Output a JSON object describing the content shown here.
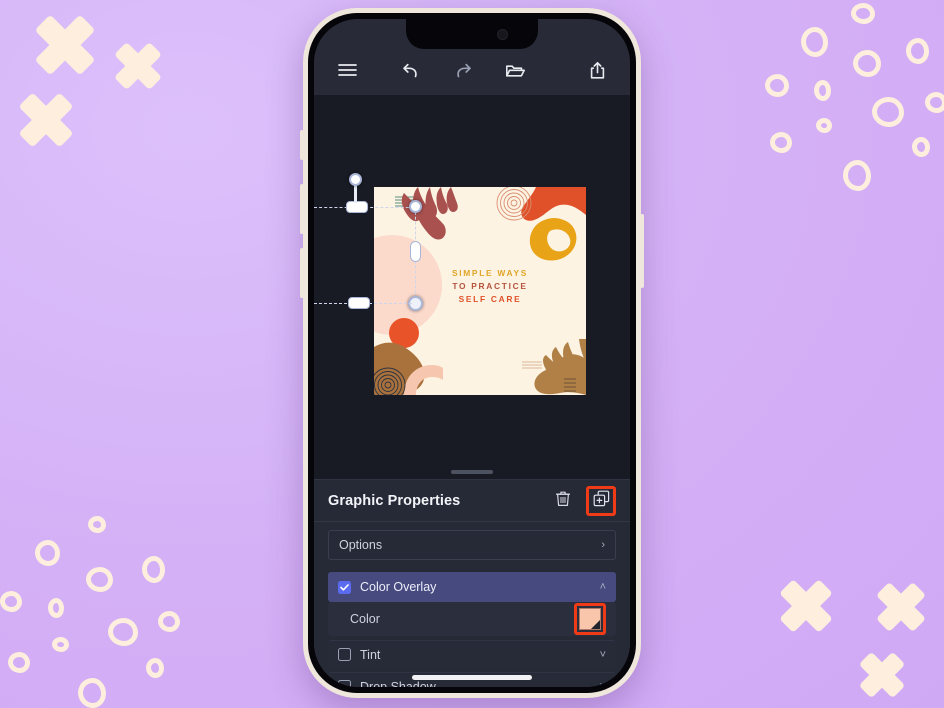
{
  "app": {
    "background_color": "#d4b0f6",
    "deco_color": "#fdeedd"
  },
  "toolbar": {
    "menu_label": "Menu",
    "undo_label": "Undo",
    "redo_label": "Redo",
    "layers_label": "Layers",
    "share_label": "Share",
    "icons": [
      "hamburger-menu-icon",
      "undo-icon",
      "redo-icon",
      "folder-layers-icon",
      "share-icon"
    ]
  },
  "canvas": {
    "artwork": {
      "title_lines": [
        "SIMPLE WAYS",
        "TO PRACTICE",
        "SELF CARE"
      ],
      "line_colors": [
        "#e0a526",
        "#b5543f",
        "#e0512a"
      ],
      "background_color": "#fdf3e2"
    },
    "selection": {
      "handles": [
        "gradient-start-handle",
        "gradient-mid-handle",
        "gradient-end-handle"
      ]
    }
  },
  "sheet": {
    "title": "Graphic Properties",
    "delete_label": "Delete",
    "duplicate_label": "Duplicate",
    "highlight_color": "#ef3b18",
    "rows": [
      {
        "label": "Options",
        "type": "nav",
        "chevron": "›"
      },
      {
        "label": "Color Overlay",
        "type": "toggle",
        "checked": true,
        "chevron": "˄",
        "accent": "#5b6bf0"
      },
      {
        "label": "Color",
        "type": "color",
        "value": "#f9c6ab"
      },
      {
        "label": "Tint",
        "type": "toggle",
        "checked": false,
        "chevron": "˅"
      },
      {
        "label": "Drop Shadow",
        "type": "toggle",
        "checked": false,
        "chevron": "˅"
      }
    ]
  }
}
